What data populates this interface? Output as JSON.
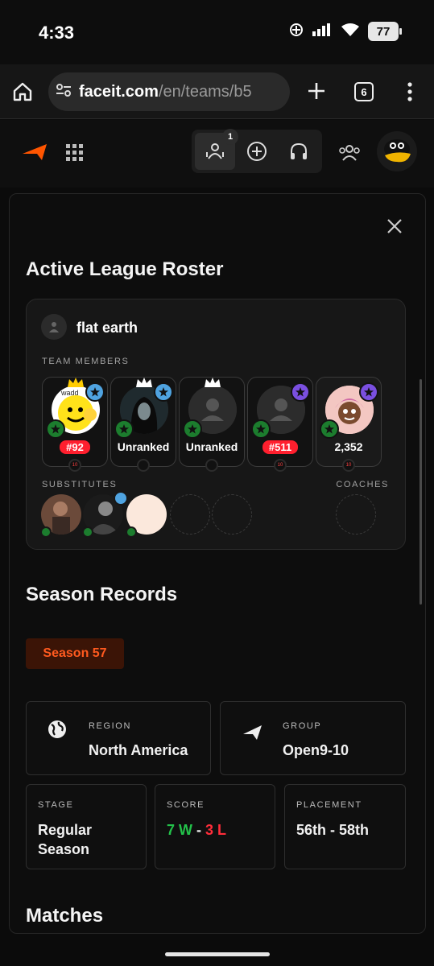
{
  "status_bar": {
    "time": "4:33",
    "battery": "77"
  },
  "browser": {
    "url_host": "faceit.com",
    "url_path": "/en/teams/b5",
    "tab_count": "6"
  },
  "header": {
    "notification_count": "1"
  },
  "roster": {
    "title": "Active League Roster",
    "team_name": "flat earth",
    "members_label": "TEAM MEMBERS",
    "members": [
      {
        "value": "#92",
        "type": "rank",
        "star_color": "#4fa3e0",
        "level": "10"
      },
      {
        "value": "Unranked",
        "type": "text",
        "star_color": "#4fa3e0",
        "level": ""
      },
      {
        "value": "Unranked",
        "type": "text",
        "star_color": "",
        "level": ""
      },
      {
        "value": "#511",
        "type": "rank",
        "star_color": "#7a4fe0",
        "level": "10"
      },
      {
        "value": "2,352",
        "type": "text",
        "star_color": "#7a4fe0",
        "level": "10"
      }
    ],
    "substitutes_label": "SUBSTITUTES",
    "coaches_label": "COACHES"
  },
  "season_records": {
    "title": "Season Records",
    "season": "Season 57",
    "region_label": "REGION",
    "region_value": "North America",
    "group_label": "GROUP",
    "group_value": "Open9-10",
    "stage_label": "STAGE",
    "stage_value": "Regular Season",
    "score_label": "SCORE",
    "score_wins": "7 W",
    "score_sep": " - ",
    "score_losses": "3 L",
    "placement_label": "PLACEMENT",
    "placement_value": "56th - 58th"
  },
  "matches": {
    "title": "Matches"
  },
  "colors": {
    "accent": "#ff5500",
    "win": "#23c24a",
    "loss": "#ff2d3a"
  }
}
